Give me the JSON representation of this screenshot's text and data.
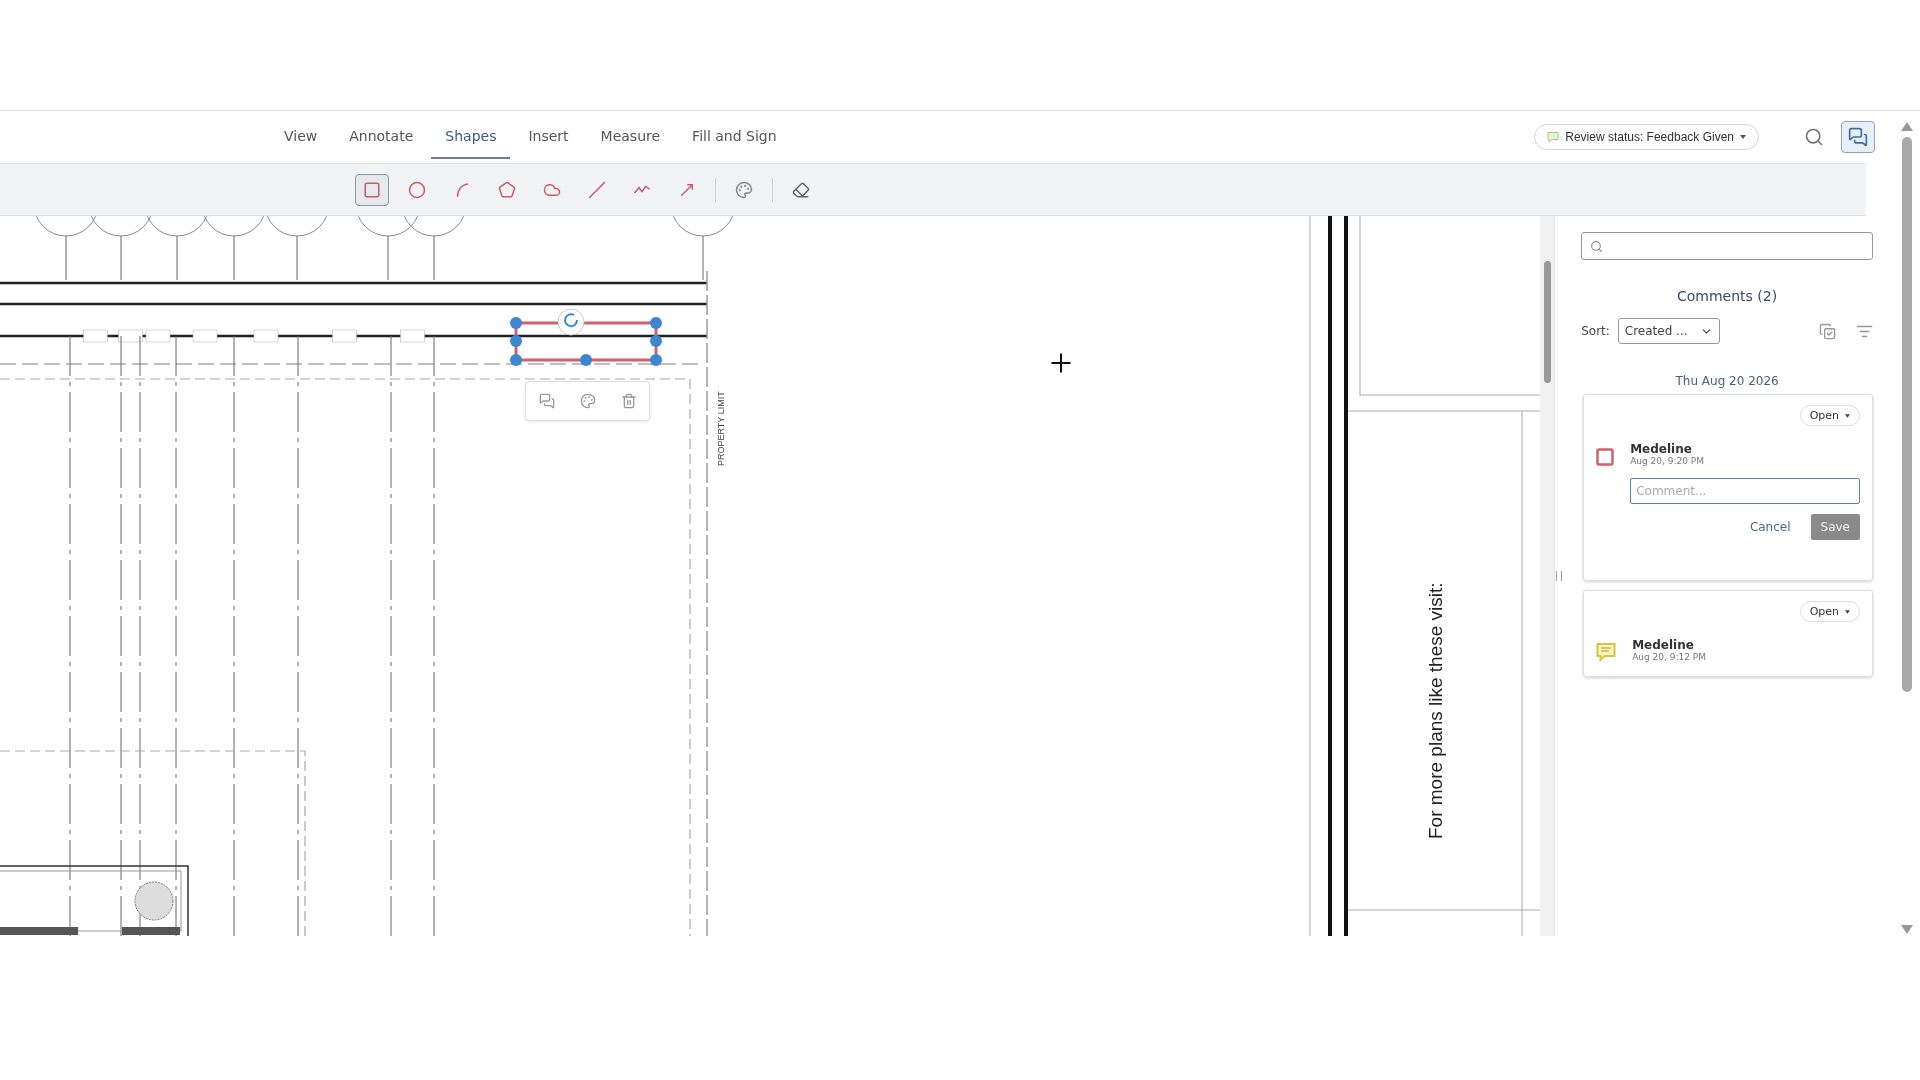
{
  "tabs": [
    {
      "label": "View",
      "selected": false
    },
    {
      "label": "Annotate",
      "selected": false
    },
    {
      "label": "Shapes",
      "selected": true
    },
    {
      "label": "Insert",
      "selected": false
    },
    {
      "label": "Measure",
      "selected": false
    },
    {
      "label": "Fill and Sign",
      "selected": false
    }
  ],
  "review_status": {
    "label": "Review status: Feedback Given"
  },
  "shape_tools": [
    {
      "kind": "rectangle",
      "selected": true
    },
    {
      "kind": "ellipse",
      "selected": false
    },
    {
      "kind": "arc",
      "selected": false
    },
    {
      "kind": "polygon",
      "selected": false
    },
    {
      "kind": "cloud",
      "selected": false
    },
    {
      "kind": "line",
      "selected": false
    },
    {
      "kind": "polyline",
      "selected": false
    },
    {
      "kind": "arrow",
      "selected": false
    }
  ],
  "drawing": {
    "side_label": "PROPERTY LIMIT",
    "note": "For more plans like these visit:"
  },
  "comments_panel": {
    "title": "Comments (2)",
    "sort_label": "Sort:",
    "sort_value": "Created ...",
    "date": "Thu Aug 20 2026",
    "comments": [
      {
        "kind": "rectangle",
        "author": "Medeline",
        "time": "Aug 20, 9:20 PM",
        "status": "Open",
        "editing": true,
        "placeholder": "Comment...",
        "cancel": "Cancel",
        "save": "Save"
      },
      {
        "kind": "note",
        "author": "Medeline",
        "time": "Aug 20, 9:12 PM",
        "status": "Open",
        "editing": false
      }
    ]
  }
}
